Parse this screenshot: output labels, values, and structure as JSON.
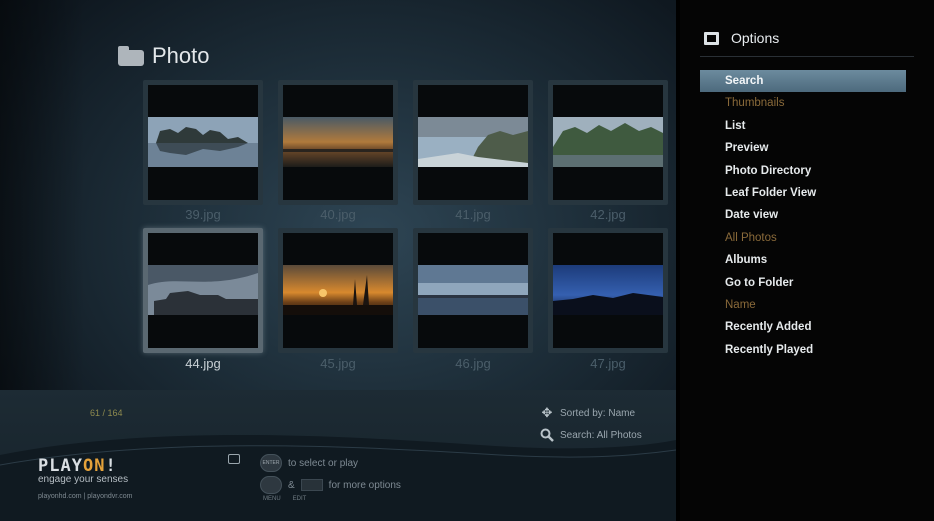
{
  "header": {
    "title": "Photo"
  },
  "grid": {
    "tiles": [
      {
        "label": "39.jpg",
        "selected": false
      },
      {
        "label": "40.jpg",
        "selected": false
      },
      {
        "label": "41.jpg",
        "selected": false
      },
      {
        "label": "42.jpg",
        "selected": false
      },
      {
        "label": "44.jpg",
        "selected": true
      },
      {
        "label": "45.jpg",
        "selected": false
      },
      {
        "label": "46.jpg",
        "selected": false
      },
      {
        "label": "47.jpg",
        "selected": false
      }
    ]
  },
  "status": {
    "counter": "61 / 164",
    "sorted_by": "Sorted by: Name",
    "search": "Search: All Photos"
  },
  "logo": {
    "name_prefix": "PLAY",
    "name_accent": "ON",
    "name_suffix": "!",
    "tagline": "engage your senses",
    "sites": "playonhd.com | playondvr.com"
  },
  "hints": {
    "select_button": "ENTER",
    "select_text": "to select or play",
    "more_text": "for more options",
    "menu_label": "MENU",
    "edit_label": "EDIT",
    "amp": "&"
  },
  "options": {
    "title": "Options",
    "items": [
      {
        "label": "Search",
        "state": "active"
      },
      {
        "label": "Thumbnails",
        "state": "dim"
      },
      {
        "label": "List",
        "state": "normal"
      },
      {
        "label": "Preview",
        "state": "normal"
      },
      {
        "label": "Photo Directory",
        "state": "normal"
      },
      {
        "label": "Leaf Folder View",
        "state": "normal"
      },
      {
        "label": "Date view",
        "state": "normal"
      },
      {
        "label": "All Photos",
        "state": "dim"
      },
      {
        "label": "Albums",
        "state": "normal"
      },
      {
        "label": "Go to Folder",
        "state": "normal"
      },
      {
        "label": "Name",
        "state": "dim"
      },
      {
        "label": "Recently Added",
        "state": "normal"
      },
      {
        "label": "Recently Played",
        "state": "normal"
      }
    ]
  },
  "colors": {
    "accent_orange": "#e5a23a",
    "dim_option": "#8a6a3a",
    "highlight": "#5c7a8d"
  }
}
